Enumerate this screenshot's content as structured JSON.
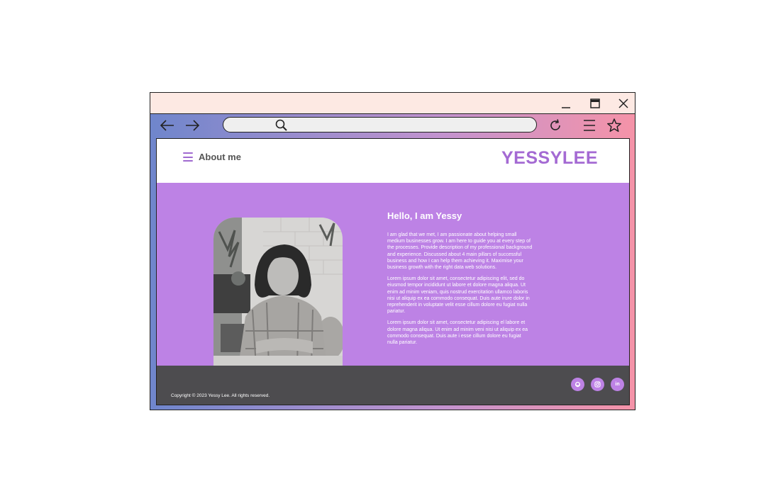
{
  "site": {
    "menu_label": "About me",
    "brand": "YESSYLEE"
  },
  "hero": {
    "heading": "Hello, I am Yessy",
    "paragraphs": [
      "I am glad that we met, I am passionate about helping small medium businesses grow. I am here to guide you at every step of the processes. Provide description of my professional background and experience. Discussed about 4 main pillars of successful business and how I can help them achieving it. Maximise your business growth with the right data web solutions.",
      "Lorem ipsum dolor sit amet, consectetur adipiscing elit, sed do eiusmod tempor incididunt ut labore et dolore magna aliqua. Ut enim ad minim veniam, quis nostrud exercitation ullamco laboris nisi ut aliquip ex ea commodo consequat. Duis aute irure dolor in reprehenderit in voluptate velit esse cillum dolore eu fugiat nulla pariatur.",
      "Lorem ipsum dolor sit amet, consectetur adipiscing el labore et dolore magna aliqua. Ut enim ad minim veni nisi ut aliquip ex ea commodo consequat. Duis aute i esse cillum dolore eu fugiat nulla pariatur."
    ]
  },
  "footer": {
    "copyright": "Copyright © 2023 Yessy Lee. All rights reserved.",
    "social": [
      {
        "icon": "github-icon"
      },
      {
        "icon": "instagram-icon"
      },
      {
        "icon": "linkedin-icon",
        "label": "in"
      }
    ]
  },
  "colors": {
    "accent": "#bd82e5",
    "brand": "#a46ad3",
    "footer": "#4d4c4f",
    "titlebar": "#fde9e3"
  }
}
